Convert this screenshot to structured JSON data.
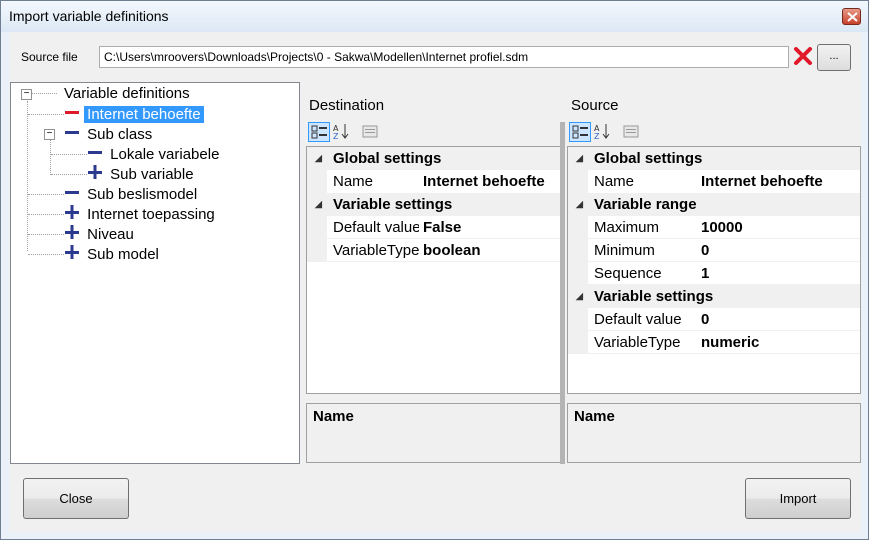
{
  "window": {
    "title": "Import variable definitions"
  },
  "source": {
    "label": "Source file",
    "path": "C:\\Users\\mroovers\\Downloads\\Projects\\0 - Sakwa\\Modellen\\Internet profiel.sdm",
    "browse_label": "..."
  },
  "tree": {
    "root": "Variable definitions",
    "items": [
      {
        "label": "Internet behoefte",
        "icon": "minus-red"
      },
      {
        "label": "Sub class",
        "icon": "minus-blue"
      },
      {
        "label": "Lokale variabele",
        "icon": "minus-blue"
      },
      {
        "label": "Sub variable",
        "icon": "plus-blue"
      },
      {
        "label": "Sub beslismodel",
        "icon": "minus-blue"
      },
      {
        "label": "Internet toepassing",
        "icon": "plus-blue"
      },
      {
        "label": "Niveau",
        "icon": "plus-blue"
      },
      {
        "label": "Sub model",
        "icon": "plus-blue"
      }
    ]
  },
  "destination": {
    "header": "Destination",
    "categories": [
      {
        "name": "Global settings",
        "props": [
          {
            "name": "Name",
            "value": "Internet behoefte"
          }
        ]
      },
      {
        "name": "Variable settings",
        "props": [
          {
            "name": "Default value",
            "value": "False"
          },
          {
            "name": "VariableType",
            "value": "boolean"
          }
        ]
      }
    ],
    "desc_title": "Name"
  },
  "source_panel": {
    "header": "Source",
    "categories": [
      {
        "name": "Global settings",
        "props": [
          {
            "name": "Name",
            "value": "Internet behoefte"
          }
        ]
      },
      {
        "name": "Variable range",
        "props": [
          {
            "name": "Maximum",
            "value": "10000"
          },
          {
            "name": "Minimum",
            "value": "0"
          },
          {
            "name": "Sequence",
            "value": "1"
          }
        ]
      },
      {
        "name": "Variable settings",
        "props": [
          {
            "name": "Default value",
            "value": "0"
          },
          {
            "name": "VariableType",
            "value": "numeric"
          }
        ]
      }
    ],
    "desc_title": "Name"
  },
  "buttons": {
    "close": "Close",
    "import": "Import"
  },
  "colors": {
    "selection": "#3399ff",
    "icon_blue": "#2b3a8f",
    "icon_red": "#e0192a"
  }
}
